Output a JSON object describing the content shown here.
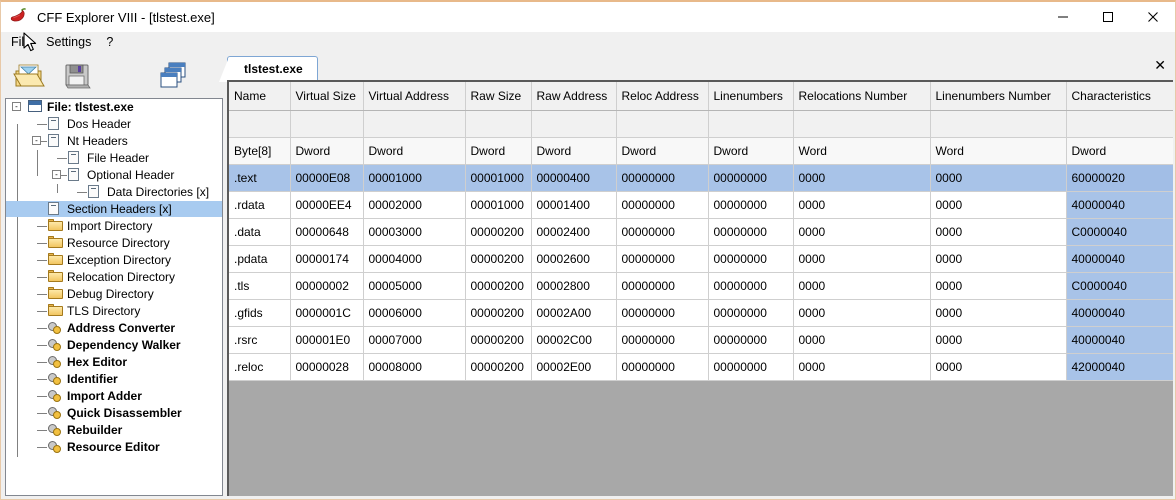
{
  "window": {
    "title": "CFF Explorer VIII - [tlstest.exe]",
    "app_icon": "chili-pepper-icon",
    "minimize_label": "—",
    "maximize_label": "☐",
    "close_label": "✕"
  },
  "menubar": {
    "items": [
      {
        "label": "File"
      },
      {
        "label": "Settings"
      },
      {
        "label": "?"
      }
    ]
  },
  "toolbar": {
    "buttons": [
      {
        "name": "open-file-button",
        "icon": "open-folder-icon"
      },
      {
        "name": "save-file-button",
        "icon": "floppy-disk-icon"
      },
      {
        "name": "windows-button",
        "icon": "cascade-windows-icon"
      }
    ]
  },
  "tabs": {
    "items": [
      {
        "label": "tlstest.exe",
        "active": true
      }
    ],
    "close_label": "✕"
  },
  "tree": {
    "root": {
      "label": "File: tlstest.exe",
      "icon": "window-icon",
      "expanded": true
    },
    "items": [
      {
        "label": "Dos Header",
        "icon": "doc-icon",
        "level": 1,
        "selected": false
      },
      {
        "label": "Nt Headers",
        "icon": "doc-icon",
        "level": 1,
        "selected": false,
        "expander": "-"
      },
      {
        "label": "File Header",
        "icon": "doc-icon",
        "level": 2,
        "selected": false
      },
      {
        "label": "Optional Header",
        "icon": "doc-icon",
        "level": 2,
        "selected": false,
        "expander": "-"
      },
      {
        "label": "Data Directories [x]",
        "icon": "doc-icon",
        "level": 3,
        "selected": false
      },
      {
        "label": "Section Headers [x]",
        "icon": "doc-icon",
        "level": 1,
        "selected": true
      },
      {
        "label": "Import Directory",
        "icon": "folder-icon",
        "level": 1,
        "selected": false
      },
      {
        "label": "Resource Directory",
        "icon": "folder-icon",
        "level": 1,
        "selected": false
      },
      {
        "label": "Exception Directory",
        "icon": "folder-icon",
        "level": 1,
        "selected": false
      },
      {
        "label": "Relocation Directory",
        "icon": "folder-icon",
        "level": 1,
        "selected": false
      },
      {
        "label": "Debug Directory",
        "icon": "folder-icon",
        "level": 1,
        "selected": false
      },
      {
        "label": "TLS Directory",
        "icon": "folder-icon",
        "level": 1,
        "selected": false
      },
      {
        "label": "Address Converter",
        "icon": "gear-icon",
        "level": 1,
        "selected": false,
        "bold": true
      },
      {
        "label": "Dependency Walker",
        "icon": "gear-icon",
        "level": 1,
        "selected": false,
        "bold": true
      },
      {
        "label": "Hex Editor",
        "icon": "gear-icon",
        "level": 1,
        "selected": false,
        "bold": true
      },
      {
        "label": "Identifier",
        "icon": "gear-icon",
        "level": 1,
        "selected": false,
        "bold": true
      },
      {
        "label": "Import Adder",
        "icon": "gear-icon",
        "level": 1,
        "selected": false,
        "bold": true
      },
      {
        "label": "Quick Disassembler",
        "icon": "gear-icon",
        "level": 1,
        "selected": false,
        "bold": true
      },
      {
        "label": "Rebuilder",
        "icon": "gear-icon",
        "level": 1,
        "selected": false,
        "bold": true
      },
      {
        "label": "Resource Editor",
        "icon": "gear-icon",
        "level": 1,
        "selected": false,
        "bold": true
      }
    ]
  },
  "section_table": {
    "columns": [
      "Name",
      "Virtual Size",
      "Virtual Address",
      "Raw Size",
      "Raw Address",
      "Reloc Address",
      "Linenumbers",
      "Relocations Number",
      "Linenumbers Number",
      "Characteristics"
    ],
    "types": [
      "Byte[8]",
      "Dword",
      "Dword",
      "Dword",
      "Dword",
      "Dword",
      "Dword",
      "Word",
      "Word",
      "Dword"
    ],
    "blank_row": [
      "",
      "",
      "",
      "",
      "",
      "",
      "",
      "",
      "",
      ""
    ],
    "selected_row_index": 0,
    "selected_column_index": 9,
    "rows": [
      [
        ".text",
        "00000E08",
        "00001000",
        "00001000",
        "00000400",
        "00000000",
        "00000000",
        "0000",
        "0000",
        "60000020"
      ],
      [
        ".rdata",
        "00000EE4",
        "00002000",
        "00001000",
        "00001400",
        "00000000",
        "00000000",
        "0000",
        "0000",
        "40000040"
      ],
      [
        ".data",
        "00000648",
        "00003000",
        "00000200",
        "00002400",
        "00000000",
        "00000000",
        "0000",
        "0000",
        "C0000040"
      ],
      [
        ".pdata",
        "00000174",
        "00004000",
        "00000200",
        "00002600",
        "00000000",
        "00000000",
        "0000",
        "0000",
        "40000040"
      ],
      [
        ".tls",
        "00000002",
        "00005000",
        "00000200",
        "00002800",
        "00000000",
        "00000000",
        "0000",
        "0000",
        "C0000040"
      ],
      [
        ".gfids",
        "0000001C",
        "00006000",
        "00000200",
        "00002A00",
        "00000000",
        "00000000",
        "0000",
        "0000",
        "40000040"
      ],
      [
        ".rsrc",
        "000001E0",
        "00007000",
        "00000200",
        "00002C00",
        "00000000",
        "00000000",
        "0000",
        "0000",
        "40000040"
      ],
      [
        ".reloc",
        "00000028",
        "00008000",
        "00000200",
        "00002E00",
        "00000000",
        "00000000",
        "0000",
        "0000",
        "42000040"
      ]
    ]
  },
  "colors": {
    "selection_blue": "#a8c3e8",
    "tree_selection": "#a8cbf0",
    "window_border": "#e8b98a",
    "empty_area": "#a8a8a8"
  }
}
